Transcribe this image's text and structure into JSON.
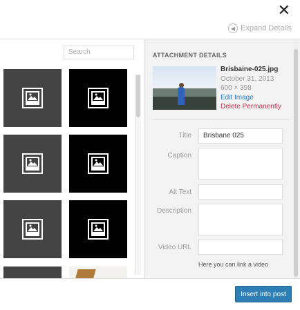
{
  "modal": {
    "close_glyph": "✕",
    "expand_label": "Expand Details",
    "expand_glyph": "◀"
  },
  "library": {
    "search_placeholder": "Search",
    "thumbnails": [
      {
        "kind": "placeholder",
        "style": "gray"
      },
      {
        "kind": "placeholder",
        "style": "black"
      },
      {
        "kind": "placeholder",
        "style": "gray"
      },
      {
        "kind": "placeholder",
        "style": "black"
      },
      {
        "kind": "placeholder",
        "style": "gray"
      },
      {
        "kind": "placeholder",
        "style": "black"
      }
    ],
    "icon": "image-placeholder-icon"
  },
  "details": {
    "heading": "ATTACHMENT DETAILS",
    "filename": "Brisbaine-025.jpg",
    "date": "October 31, 2013",
    "dimensions": "600 × 398",
    "edit_link": "Edit Image",
    "delete_link": "Delete Permanently",
    "fields": {
      "title_label": "Title",
      "title_value": "Brisbane 025",
      "caption_label": "Caption",
      "alt_label": "Alt Text",
      "description_label": "Description",
      "video_url_label": "Video URL"
    },
    "hint": "Here you can link a video"
  },
  "footer": {
    "insert_label": "Insert into post"
  },
  "colors": {
    "accent": "#2e7fb5",
    "danger": "#c0304a",
    "link": "#2b77b5"
  }
}
